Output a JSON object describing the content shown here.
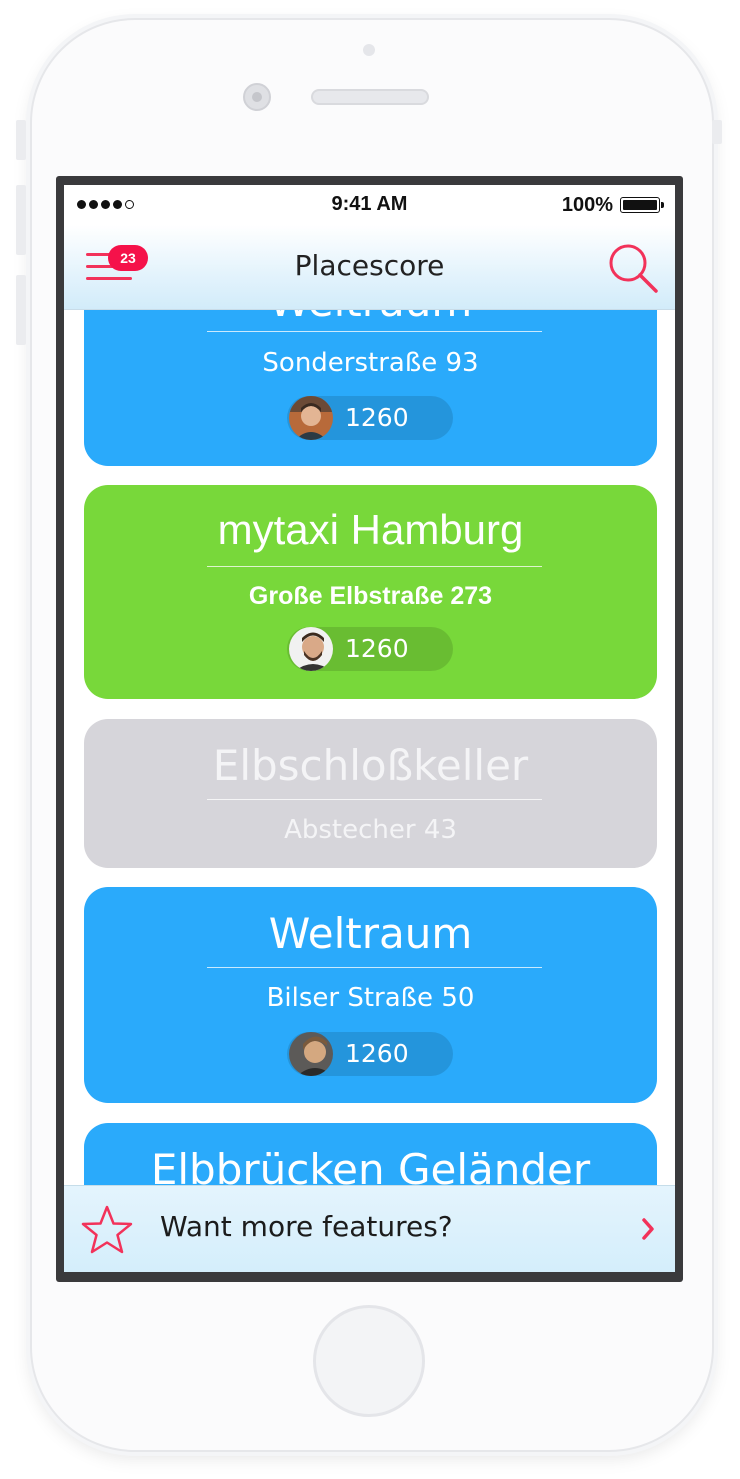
{
  "status_bar": {
    "time": "9:41 AM",
    "battery": "100%"
  },
  "nav": {
    "title": "Placescore",
    "badge_count": "23"
  },
  "cards": [
    {
      "title": "Weltraum",
      "address": "Sonderstraße 93",
      "score": "1260",
      "color": "#2aaafb"
    },
    {
      "title": "mytaxi Hamburg",
      "address": "Große Elbstraße 273",
      "score": "1260",
      "color": "#78d83a"
    },
    {
      "title": "Elbschloßkeller",
      "address": "Abstecher 43",
      "color": "#d6d5da"
    },
    {
      "title": "Weltraum",
      "address": "Bilser Straße 50",
      "score": "1260",
      "color": "#2aaafb"
    },
    {
      "title": "Elbbrücken Geländer",
      "color": "#2aaafb"
    }
  ],
  "promo": {
    "text": "Want more features?"
  },
  "colors": {
    "accent": "#f2325a",
    "nav_bg": "#d2ecfa"
  }
}
